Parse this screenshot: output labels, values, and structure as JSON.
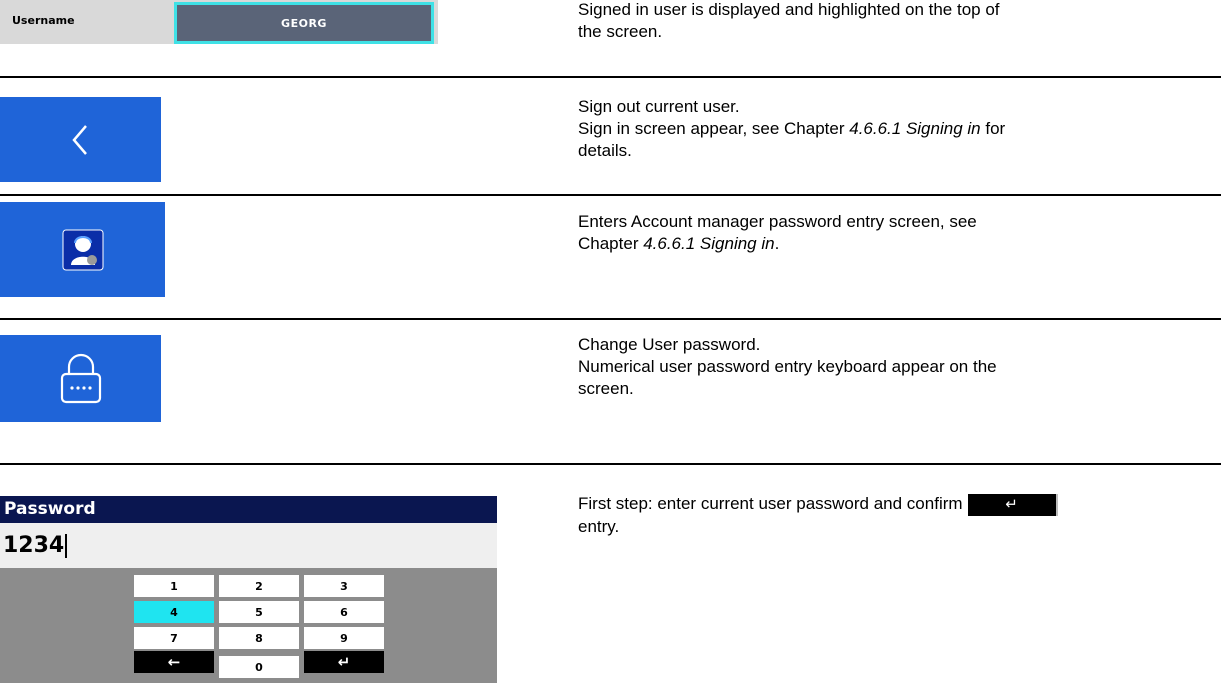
{
  "row1": {
    "username_label": "Username",
    "username_value": "GEORG",
    "description": "Signed in user is displayed and highlighted on the top of the screen."
  },
  "row2": {
    "icon": "chevron-left-icon",
    "desc_line1": "Sign out current user.",
    "desc_line2_pre": "Sign in screen appear, see Chapter ",
    "desc_line2_ref": "4.6.6.1 Signing in",
    "desc_line2_post": " for details."
  },
  "row3": {
    "icon": "account-manager-icon",
    "desc_pre": "Enters Account manager password entry screen, see Chapter ",
    "desc_ref": "4.6.6.1 Signing in",
    "desc_post": "."
  },
  "row4": {
    "icon": "lock-icon",
    "desc_line1": "Change User password.",
    "desc_line2": "Numerical user password entry keyboard appear on the screen."
  },
  "row5": {
    "header": "Password",
    "entry_value": "1234",
    "keys": [
      "1",
      "2",
      "3",
      "4",
      "5",
      "6",
      "7",
      "8",
      "9",
      "←",
      "0",
      "↵"
    ],
    "selected_key": "4",
    "desc_pre": "First step: enter current user password and confirm",
    "enter_glyph": "↵",
    "desc_post": "entry."
  },
  "colors": {
    "tile_blue": "#1f64d8",
    "highlight_cyan": "#1fe4f0",
    "header_navy": "#0a1650",
    "username_box": "#5a6478"
  }
}
